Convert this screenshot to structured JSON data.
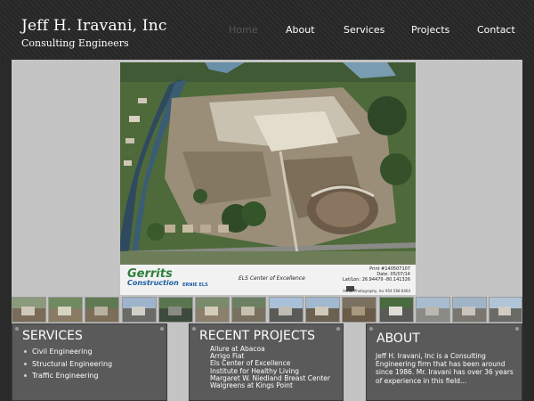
{
  "header": {
    "title": "Jeff H. Iravani, Inc",
    "subtitle": "Consulting Engineers"
  },
  "nav": {
    "items": [
      {
        "label": "Home",
        "active": true
      },
      {
        "label": "About"
      },
      {
        "label": "Services"
      },
      {
        "label": "Projects"
      },
      {
        "label": "Contact"
      }
    ]
  },
  "hero": {
    "logo_primary": "Gerrits",
    "logo_secondary": "Construction",
    "logo_partner": "ERNIE ELS",
    "caption_center": "ELS Center of Excellence",
    "caption_lines": [
      "Print #140507107",
      "Date: 05/07/14",
      "Lat/Lon: 26.94479 -80.141326"
    ],
    "credit": "Aerial Photography, Inc 954 568 6464"
  },
  "colors": {
    "header_bg": "#2a2a2a",
    "content_bg": "#c4c4c4",
    "panel_bg": "#5a5a5a",
    "nav_active": "#5a5650"
  },
  "services": {
    "title": "SERVICES",
    "items": [
      "Civil Engineering",
      "Structural Engineering",
      "Traffic Engineering"
    ]
  },
  "projects": {
    "title": "RECENT PROJECTS",
    "items": [
      "Allure at Abacoa",
      "Arrigo Fiat",
      "Els Center of Excellence",
      "Institute for Healthy Living",
      "Margaret W. Niedland Breast Center",
      "Walgreens at Kings Point"
    ]
  },
  "about": {
    "title": "ABOUT",
    "text": "Jeff H. Iravani, Inc is a Consulting Engineering firm that has been around since 1986. Mr. Iravani has over 36 years of experience in this field..."
  }
}
